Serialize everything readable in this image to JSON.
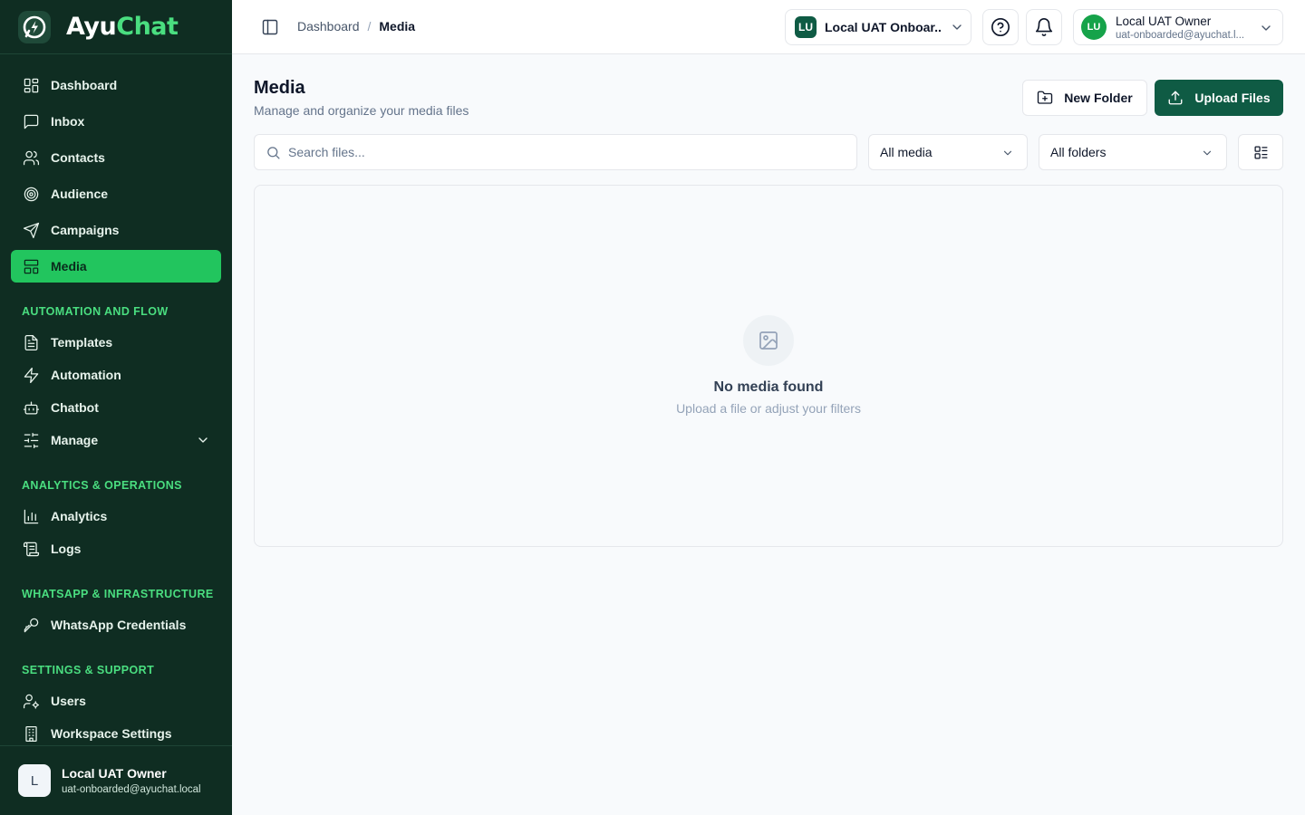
{
  "app": {
    "name_part1": "Ayu",
    "name_part2": "Chat"
  },
  "sidebar": {
    "items": [
      {
        "label": "Dashboard",
        "icon": "grid-icon"
      },
      {
        "label": "Inbox",
        "icon": "message-icon"
      },
      {
        "label": "Contacts",
        "icon": "users-icon"
      },
      {
        "label": "Audience",
        "icon": "target-icon"
      },
      {
        "label": "Campaigns",
        "icon": "send-icon"
      },
      {
        "label": "Media",
        "icon": "media-layout-icon",
        "active": true
      }
    ],
    "sections": [
      {
        "title": "AUTOMATION AND FLOW",
        "items": [
          {
            "label": "Templates",
            "icon": "file-text-icon"
          },
          {
            "label": "Automation",
            "icon": "zap-icon"
          },
          {
            "label": "Chatbot",
            "icon": "bot-icon"
          },
          {
            "label": "Manage",
            "icon": "sliders-icon"
          }
        ]
      },
      {
        "title": "ANALYTICS & OPERATIONS",
        "items": [
          {
            "label": "Analytics",
            "icon": "bar-chart-icon"
          },
          {
            "label": "Logs",
            "icon": "scroll-icon"
          }
        ]
      },
      {
        "title": "WHATSAPP & INFRASTRUCTURE",
        "items": [
          {
            "label": "WhatsApp Credentials",
            "icon": "key-icon"
          }
        ]
      },
      {
        "title": "SETTINGS & SUPPORT",
        "items": [
          {
            "label": "Users",
            "icon": "user-cog-icon"
          },
          {
            "label": "Workspace Settings",
            "icon": "building-icon"
          }
        ]
      }
    ],
    "footer": {
      "avatar": "L",
      "name": "Local UAT Owner",
      "email": "uat-onboarded@ayuchat.local"
    }
  },
  "header": {
    "breadcrumb": [
      "Dashboard",
      "/",
      "Media"
    ],
    "workspace": {
      "badge": "LU",
      "label": "Local UAT Onboar..."
    },
    "user": {
      "avatar": "LU",
      "name": "Local UAT Owner",
      "email": "uat-onboarded@ayuchat.l..."
    }
  },
  "main": {
    "title": "Media",
    "subtitle": "Manage and organize your media files",
    "new_folder_label": "New Folder",
    "upload_label": "Upload Files",
    "search_placeholder": "Search files...",
    "type_filter": "All media",
    "folder_filter": "All folders",
    "empty_title": "No media found",
    "empty_subtitle": "Upload a file or adjust your filters"
  },
  "colors": {
    "sidebar_bg": "#0f2d22",
    "accent": "#22c55e",
    "primary": "#0f5b44",
    "section_title": "#4ade80"
  }
}
